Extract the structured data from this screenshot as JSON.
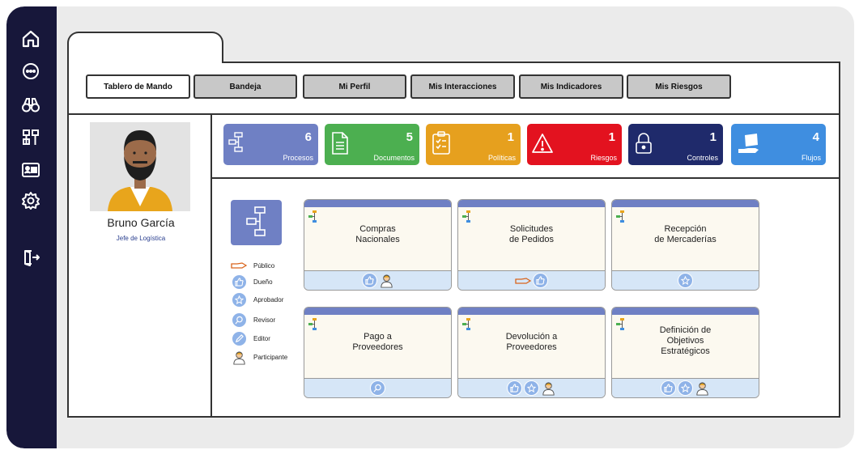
{
  "sidebar": {
    "icons": [
      "home-icon",
      "more-icon",
      "binoculars-icon",
      "workflow-icon",
      "id-card-icon",
      "settings-icon",
      "logout-icon"
    ]
  },
  "tabs": [
    {
      "label": "Tablero de Mando",
      "active": true
    },
    {
      "label": "Bandeja",
      "active": false
    },
    {
      "label": "Mi Perfil",
      "active": false
    },
    {
      "label": "Mis Interacciones",
      "active": false
    },
    {
      "label": "Mis Indicadores",
      "active": false
    },
    {
      "label": "Mis Riesgos",
      "active": false
    }
  ],
  "profile": {
    "name": "Bruno García",
    "role": "Jefe de Logística"
  },
  "kpis": [
    {
      "count": "6",
      "label": "Procesos",
      "color": "#6f80c4",
      "icon": "flowchart-icon"
    },
    {
      "count": "5",
      "label": "Documentos",
      "color": "#4caf50",
      "icon": "document-icon"
    },
    {
      "count": "1",
      "label": "Políticas",
      "color": "#e6a01e",
      "icon": "clipboard-icon"
    },
    {
      "count": "1",
      "label": "Riesgos",
      "color": "#e3121f",
      "icon": "warning-icon"
    },
    {
      "count": "1",
      "label": "Controles",
      "color": "#1f2a6b",
      "icon": "padlock-icon"
    },
    {
      "count": "4",
      "label": "Flujos",
      "color": "#3f8ee0",
      "icon": "hand-icon"
    }
  ],
  "legend": [
    {
      "label": "Público",
      "icon": "hand-public-icon"
    },
    {
      "label": "Dueño",
      "icon": "thumbs-up-icon"
    },
    {
      "label": "Aprobador",
      "icon": "star-icon"
    },
    {
      "label": "Revisor",
      "icon": "magnifier-icon"
    },
    {
      "label": "Editor",
      "icon": "pencil-icon"
    },
    {
      "label": "Participante",
      "icon": "person-icon"
    }
  ],
  "processes": [
    {
      "title": "Compras\nNacionales",
      "roles": [
        "thumbs-up-icon",
        "person-icon"
      ]
    },
    {
      "title": "Solicitudes\nde Pedidos",
      "roles": [
        "hand-public-icon",
        "thumbs-up-icon"
      ]
    },
    {
      "title": "Recepción\nde Mercaderías",
      "roles": [
        "star-icon"
      ]
    },
    {
      "title": "Pago a\nProveedores",
      "roles": [
        "magnifier-icon"
      ]
    },
    {
      "title": "Devolución a\nProveedores",
      "roles": [
        "thumbs-up-icon",
        "star-icon",
        "person-icon"
      ]
    },
    {
      "title": "Definición de\nObjetivos\nEstratégicos",
      "roles": [
        "thumbs-up-icon",
        "star-icon",
        "person-icon"
      ]
    }
  ]
}
